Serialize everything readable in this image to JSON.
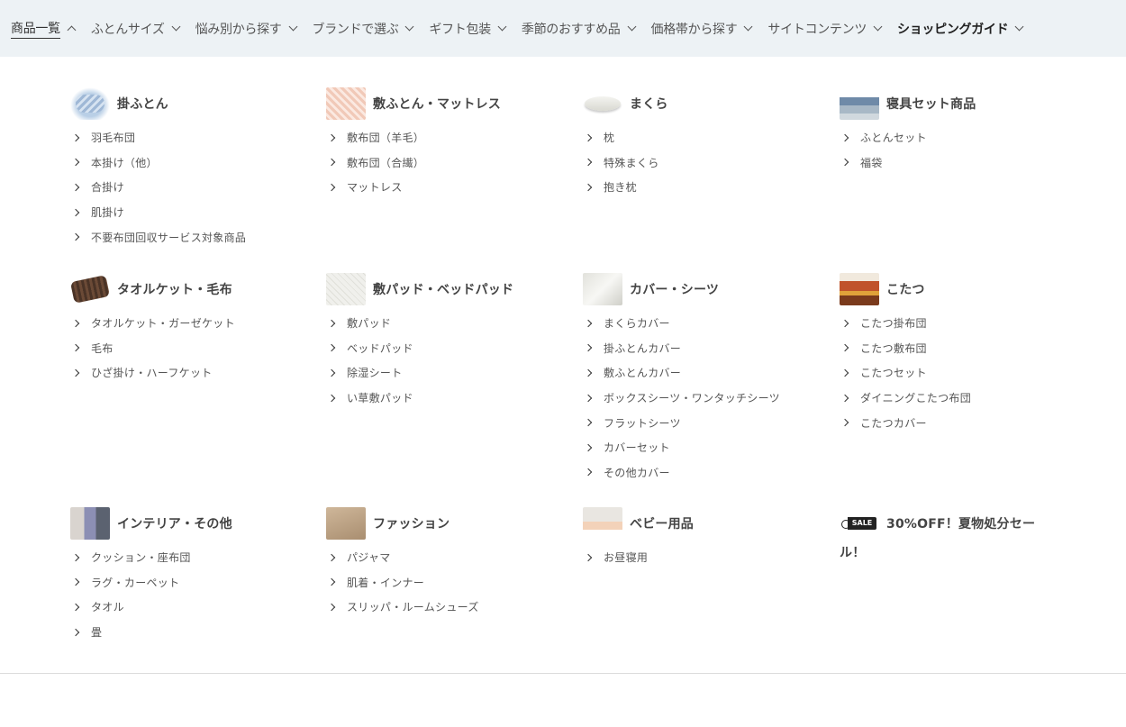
{
  "nav": [
    {
      "label": "商品一覧",
      "state": "active"
    },
    {
      "label": "ふとんサイズ"
    },
    {
      "label": "悩み別から探す"
    },
    {
      "label": "ブランドで選ぶ"
    },
    {
      "label": "ギフト包装"
    },
    {
      "label": "季節のおすすめ品"
    },
    {
      "label": "価格帯から探す"
    },
    {
      "label": "サイトコンテンツ"
    },
    {
      "label": "ショッピングガイド"
    }
  ],
  "categories": [
    {
      "title": "掛ふとん",
      "icon": "comforter-thumbnail",
      "items": [
        "羽毛布団",
        "本掛け（他）",
        "合掛け",
        "肌掛け",
        "不要布団回収サービス対象商品"
      ]
    },
    {
      "title": "敷ふとん・マットレス",
      "icon": "mattress-thumbnail",
      "items": [
        "敷布団（羊毛）",
        "敷布団（合繊）",
        "マットレス"
      ]
    },
    {
      "title": "まくら",
      "icon": "pillow-thumbnail",
      "items": [
        "枕",
        "特殊まくら",
        "抱き枕"
      ]
    },
    {
      "title": "寝具セット商品",
      "icon": "bedding-set-thumbnail",
      "items": [
        "ふとんセット",
        "福袋"
      ]
    },
    {
      "title": "タオルケット・毛布",
      "icon": "blanket-thumbnail",
      "items": [
        "タオルケット・ガーゼケット",
        "毛布",
        "ひざ掛け・ハーフケット"
      ]
    },
    {
      "title": "敷パッド・ベッドパッド",
      "icon": "bed-pad-thumbnail",
      "items": [
        "敷パッド",
        "ベッドパッド",
        "除湿シート",
        "い草敷パッド"
      ]
    },
    {
      "title": "カバー・シーツ",
      "icon": "cover-thumbnail",
      "items": [
        "まくらカバー",
        "掛ふとんカバー",
        "敷ふとんカバー",
        "ボックスシーツ・ワンタッチシーツ",
        "フラットシーツ",
        "カバーセット",
        "その他カバー"
      ]
    },
    {
      "title": "こたつ",
      "icon": "kotatsu-thumbnail",
      "items": [
        "こたつ掛布団",
        "こたつ敷布団",
        "こたつセット",
        "ダイニングこたつ布団",
        "こたつカバー"
      ]
    },
    {
      "title": "インテリア・その他",
      "icon": "interior-thumbnail",
      "items": [
        "クッション・座布団",
        "ラグ・カーペット",
        "タオル",
        "畳"
      ]
    },
    {
      "title": "ファッション",
      "icon": "fashion-thumbnail",
      "items": [
        "パジャマ",
        "肌着・インナー",
        "スリッパ・ルームシューズ"
      ]
    },
    {
      "title": "ベビー用品",
      "icon": "baby-thumbnail",
      "items": [
        "お昼寝用"
      ]
    }
  ],
  "sale": {
    "title_line1": "30%OFF！夏物処分セー",
    "title_line2": "ル！",
    "icon": "sale-tag-icon"
  }
}
